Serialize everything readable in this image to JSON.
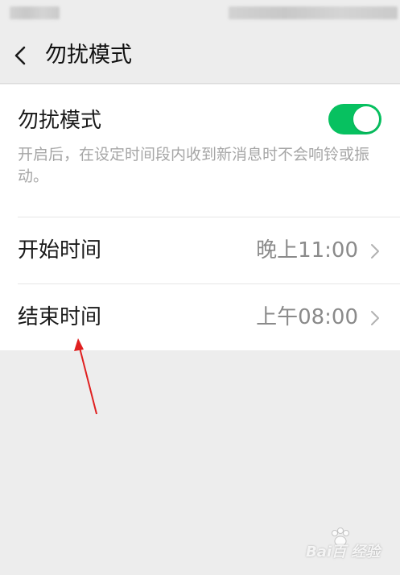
{
  "nav": {
    "title": "勿扰模式",
    "back_icon": "chevron-left-icon"
  },
  "dnd": {
    "label": "勿扰模式",
    "enabled": true,
    "description": "开启后，在设定时间段内收到新消息时不会响铃或振动。"
  },
  "rows": [
    {
      "label": "开始时间",
      "value": "晚上11:00"
    },
    {
      "label": "结束时间",
      "value": "上午08:00"
    }
  ],
  "colors": {
    "accent_green": "#07c160",
    "annotation_arrow": "#e02020"
  },
  "watermark": {
    "text": "Bai百 经验"
  }
}
